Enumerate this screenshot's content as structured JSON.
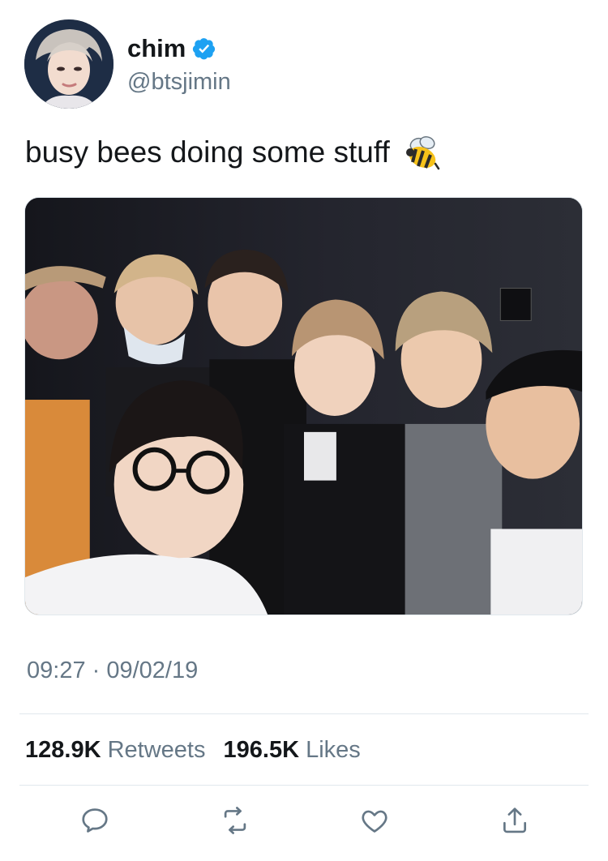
{
  "user": {
    "display_name": "chim",
    "handle": "@btsjimin",
    "verified": true
  },
  "tweet": {
    "text": "busy bees doing some stuff",
    "emoji": "bee-icon",
    "timestamp": "09:27 · 09/02/19"
  },
  "stats": {
    "retweets_count": "128.9K",
    "retweets_label": "Retweets",
    "likes_count": "196.5K",
    "likes_label": "Likes"
  },
  "actions": [
    "reply-icon",
    "retweet-icon",
    "like-icon",
    "share-icon"
  ],
  "colors": {
    "text_primary": "#14171a",
    "text_secondary": "#657786",
    "verified_blue": "#1da1f2",
    "divider": "#e1e8ed",
    "action_icon": "#657786"
  }
}
